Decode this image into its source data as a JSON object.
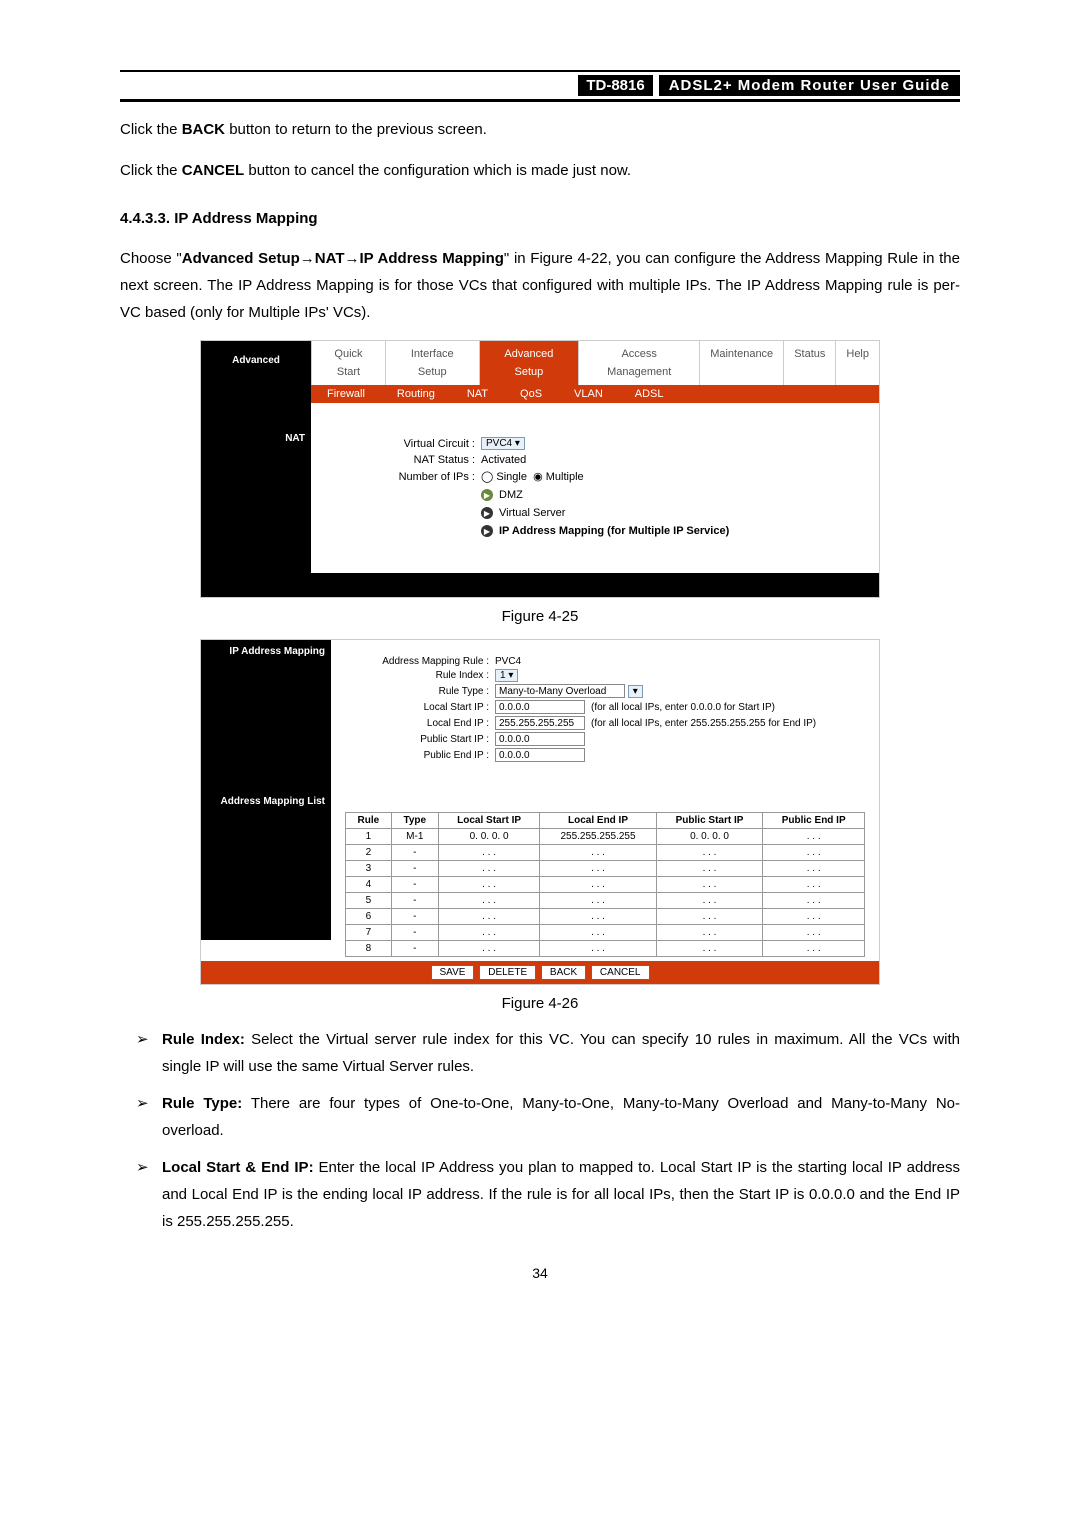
{
  "header": {
    "model": "TD-8816",
    "guide": "ADSL2+  Modem  Router  User  Guide"
  },
  "p1a": "Click the ",
  "p1b": "BACK",
  "p1c": " button to return to the previous screen.",
  "p2a": "Click the ",
  "p2b": "CANCEL",
  "p2c": " button to cancel the configuration which is made just now.",
  "section": "4.4.3.3.  IP Address Mapping",
  "p3a": "Choose \"",
  "p3b": "Advanced Setup→NAT→IP Address Mapping",
  "p3c": "\" in Figure 4-22, you can configure the Address Mapping Rule in the next screen. The IP Address Mapping is for those VCs that configured with multiple IPs. The IP Address Mapping rule is per-VC based (only for Multiple IPs' VCs).",
  "fig25": {
    "advanced": "Advanced",
    "tabs": [
      "Quick Start",
      "Interface Setup",
      "Advanced Setup",
      "Access Management",
      "Maintenance",
      "Status",
      "Help"
    ],
    "subtabs": [
      "Firewall",
      "Routing",
      "NAT",
      "QoS",
      "VLAN",
      "ADSL"
    ],
    "side": "NAT",
    "vc_label": "Virtual Circuit :",
    "vc_val": "PVC4",
    "nat_label": "NAT Status :",
    "nat_val": "Activated",
    "nip_label": "Number of IPs :",
    "nip_single": "Single",
    "nip_mult": "Multiple",
    "link_dmz": "DMZ",
    "link_vs": "Virtual Server",
    "link_ipm": "IP Address Mapping (for Multiple IP Service)",
    "caption": "Figure 4-25"
  },
  "fig26": {
    "side1": "IP Address Mapping",
    "side2": "Address Mapping List",
    "amr_label": "Address Mapping Rule :",
    "amr_val": "PVC4",
    "ri_label": "Rule Index :",
    "ri_val": "1",
    "rt_label": "Rule Type :",
    "rt_val": "Many-to-Many Overload",
    "lsi_label": "Local Start IP :",
    "lsi_val": "0.0.0.0",
    "lsi_hint": "(for all local IPs, enter 0.0.0.0 for Start IP)",
    "lei_label": "Local End IP :",
    "lei_val": "255.255.255.255",
    "lei_hint": "(for all local IPs, enter 255.255.255.255 for End IP)",
    "psi_label": "Public Start IP :",
    "psi_val": "0.0.0.0",
    "pei_label": "Public End IP :",
    "pei_val": "0.0.0.0",
    "th": [
      "Rule",
      "Type",
      "Local Start IP",
      "Local End IP",
      "Public Start IP",
      "Public End IP"
    ],
    "rows": [
      [
        "1",
        "M-1",
        "0. 0. 0. 0",
        "255.255.255.255",
        "0. 0. 0. 0",
        ". . ."
      ],
      [
        "2",
        "-",
        ". . .",
        ". . .",
        ". . .",
        ". . ."
      ],
      [
        "3",
        "-",
        ". . .",
        ". . .",
        ". . .",
        ". . ."
      ],
      [
        "4",
        "-",
        ". . .",
        ". . .",
        ". . .",
        ". . ."
      ],
      [
        "5",
        "-",
        ". . .",
        ". . .",
        ". . .",
        ". . ."
      ],
      [
        "6",
        "-",
        ". . .",
        ". . .",
        ". . .",
        ". . ."
      ],
      [
        "7",
        "-",
        ". . .",
        ". . .",
        ". . .",
        ". . ."
      ],
      [
        "8",
        "-",
        ". . .",
        ". . .",
        ". . .",
        ". . ."
      ]
    ],
    "btns": [
      "SAVE",
      "DELETE",
      "BACK",
      "CANCEL"
    ],
    "caption": "Figure 4-26"
  },
  "bul": [
    {
      "b": "Rule Index:",
      "t": " Select the Virtual server rule index for this VC. You can specify 10 rules in maximum. All the VCs with single IP will use the same Virtual Server rules."
    },
    {
      "b": "Rule Type:",
      "t": " There are four types of One-to-One, Many-to-One, Many-to-Many Overload and Many-to-Many No-overload."
    },
    {
      "b": "Local Start & End IP:",
      "t": " Enter the local IP Address you plan to mapped to. Local Start IP is the starting local IP address and Local End IP is the ending local IP address. If the rule is for all local IPs, then the Start IP is 0.0.0.0 and the End IP is 255.255.255.255."
    }
  ],
  "pagenum": "34"
}
